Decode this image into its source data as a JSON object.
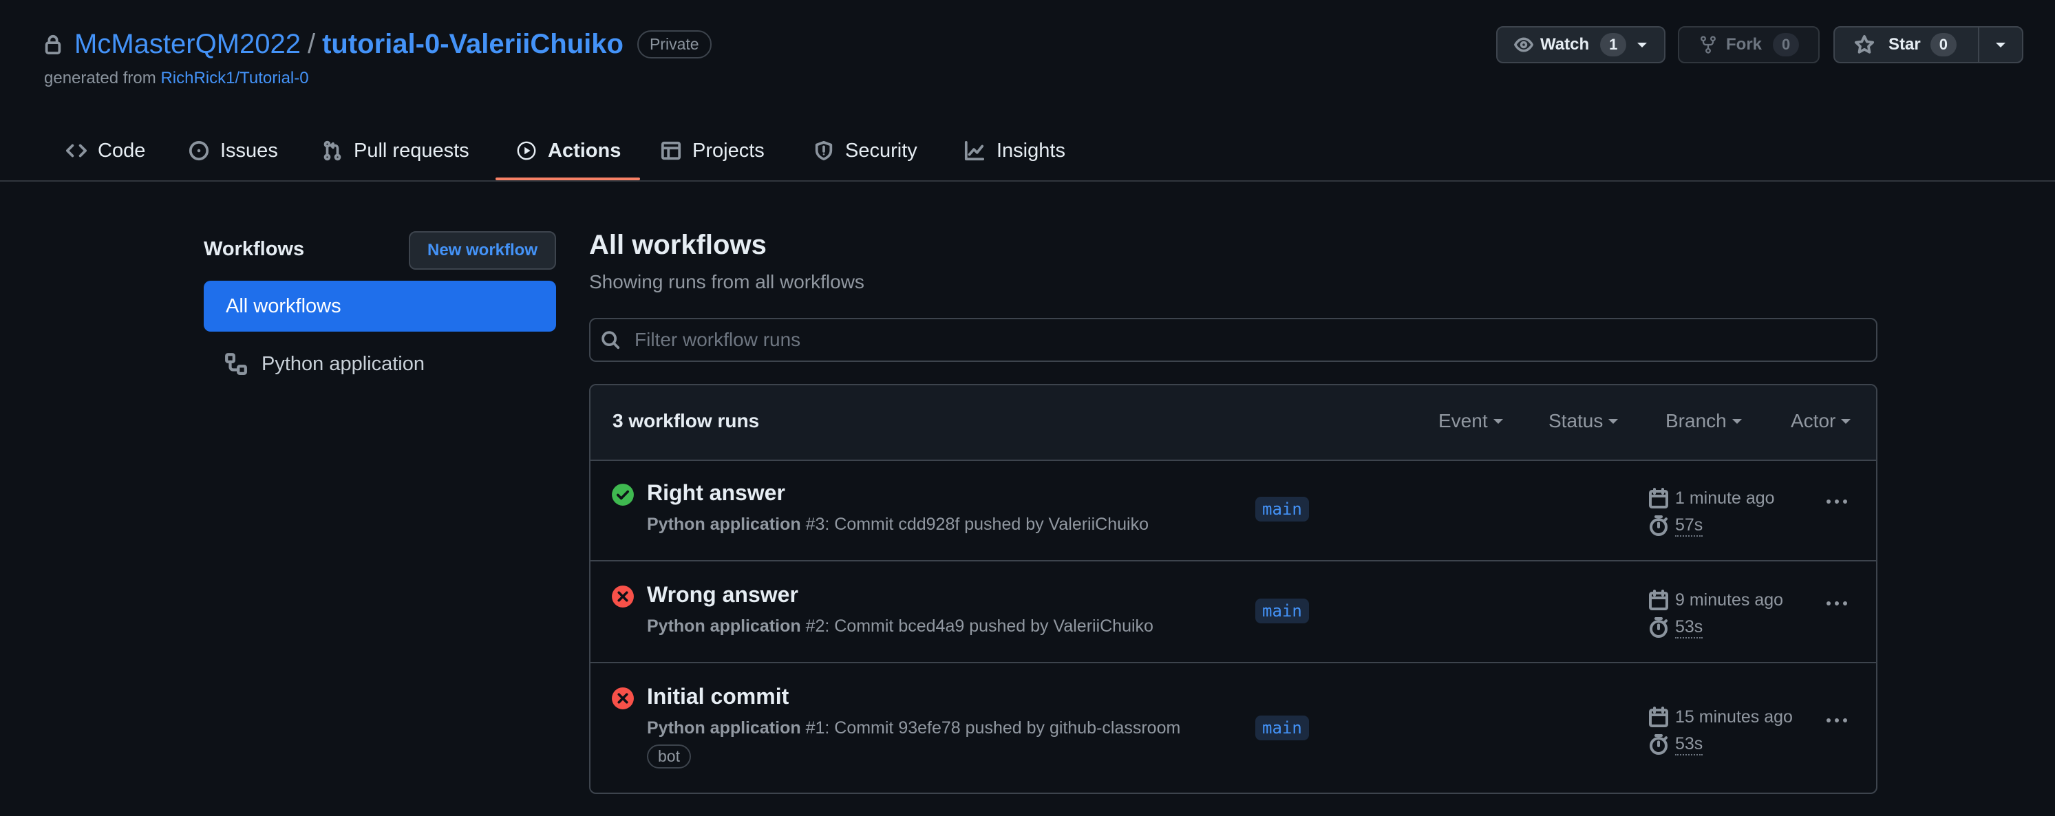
{
  "header": {
    "owner": "McMasterQM2022",
    "separator": "/",
    "repo": "tutorial-0-ValeriiChuiko",
    "visibility": "Private",
    "generated_prefix": "generated from",
    "template_repo": "RichRick1/Tutorial-0",
    "watch_label": "Watch",
    "watch_count": "1",
    "fork_label": "Fork",
    "fork_count": "0",
    "star_label": "Star",
    "star_count": "0"
  },
  "tabs": [
    {
      "label": "Code",
      "icon": "code-icon"
    },
    {
      "label": "Issues",
      "icon": "issue-opened-icon"
    },
    {
      "label": "Pull requests",
      "icon": "git-pull-request-icon"
    },
    {
      "label": "Actions",
      "icon": "play-icon",
      "active": true
    },
    {
      "label": "Projects",
      "icon": "table-icon"
    },
    {
      "label": "Security",
      "icon": "shield-icon"
    },
    {
      "label": "Insights",
      "icon": "graph-icon"
    }
  ],
  "sidebar": {
    "title": "Workflows",
    "new_workflow": "New workflow",
    "items": [
      {
        "label": "All workflows",
        "selected": true
      },
      {
        "label": "Python application",
        "icon": "workflow-icon"
      }
    ]
  },
  "main": {
    "title": "All workflows",
    "subtitle": "Showing runs from all workflows",
    "filter_placeholder": "Filter workflow runs",
    "runs_count": "3 workflow runs",
    "filters": [
      "Event",
      "Status",
      "Branch",
      "Actor"
    ],
    "runs": [
      {
        "title": "Right answer",
        "status": "success",
        "workflow": "Python application",
        "detail": " #3: Commit cdd928f pushed by ValeriiChuiko",
        "branch": "main",
        "time_ago": "1 minute ago",
        "duration": "57s"
      },
      {
        "title": "Wrong answer",
        "status": "failure",
        "workflow": "Python application",
        "detail": " #2: Commit bced4a9 pushed by ValeriiChuiko",
        "branch": "main",
        "time_ago": "9 minutes ago",
        "duration": "53s"
      },
      {
        "title": "Initial commit",
        "status": "failure",
        "workflow": "Python application",
        "detail": " #1: Commit 93efe78 pushed by github-classroom",
        "badge": "bot",
        "branch": "main",
        "time_ago": "15 minutes ago",
        "duration": "53s"
      }
    ]
  },
  "colors": {
    "background": "#0d1117",
    "accent": "#4493f8",
    "selected": "#1f6feb",
    "success": "#3fb950",
    "failure": "#f85149",
    "tab_underline": "#f78166"
  }
}
